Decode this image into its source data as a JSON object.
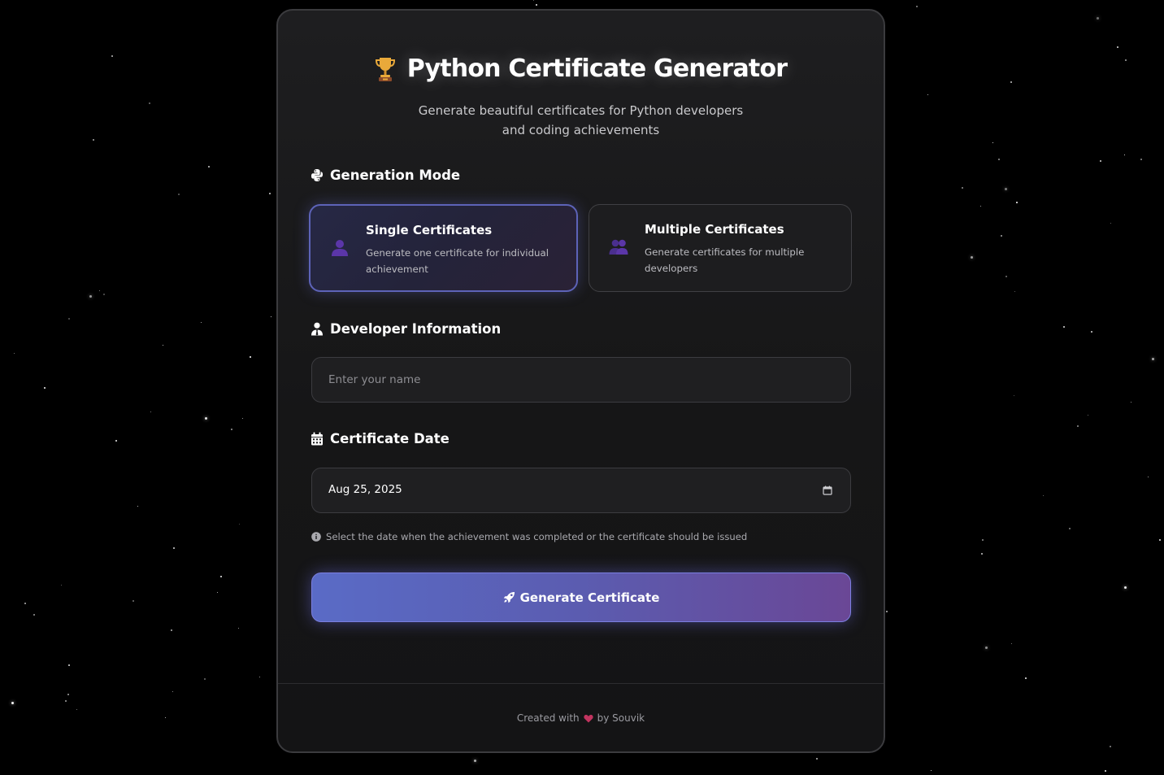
{
  "header": {
    "title": "Python Certificate Generator",
    "subtitle_line1": "Generate beautiful certificates for Python developers",
    "subtitle_line2": "and coding achievements"
  },
  "generation_mode": {
    "heading": "Generation Mode",
    "options": [
      {
        "title": "Single Certificates",
        "desc_line1": "Generate one certificate for individual",
        "desc_line2": "achievement",
        "selected": true
      },
      {
        "title": "Multiple Certificates",
        "desc_line1": "Generate certificates for multiple",
        "desc_line2": "developers",
        "selected": false
      }
    ]
  },
  "developer_info": {
    "heading": "Developer Information",
    "name_placeholder": "Enter your name",
    "name_value": ""
  },
  "certificate_date": {
    "heading": "Certificate Date",
    "value": "Aug 25, 2025",
    "hint": "Select the date when the achievement was completed or the certificate should be issued"
  },
  "generate_button": {
    "label": "Generate Certificate"
  },
  "footer": {
    "prefix": "Created with",
    "suffix": "by Souvik"
  },
  "colors": {
    "accent_start": "#5a6bc6",
    "accent_end": "#6a4796",
    "selected_border": "#5d63b8",
    "heart": "#c2345f",
    "trophy": "#e3a53a",
    "mode_icon": "#5c3aa8"
  },
  "icons": {
    "title": "trophy-icon",
    "generation_mode": "python-icon",
    "single_mode": "user-icon",
    "multiple_mode": "users-icon",
    "developer_info": "user-tie-icon",
    "certificate_date": "calendar-icon",
    "date_picker": "calendar-picker-icon",
    "hint": "info-circle-icon",
    "generate": "rocket-icon",
    "footer": "heart-icon"
  }
}
